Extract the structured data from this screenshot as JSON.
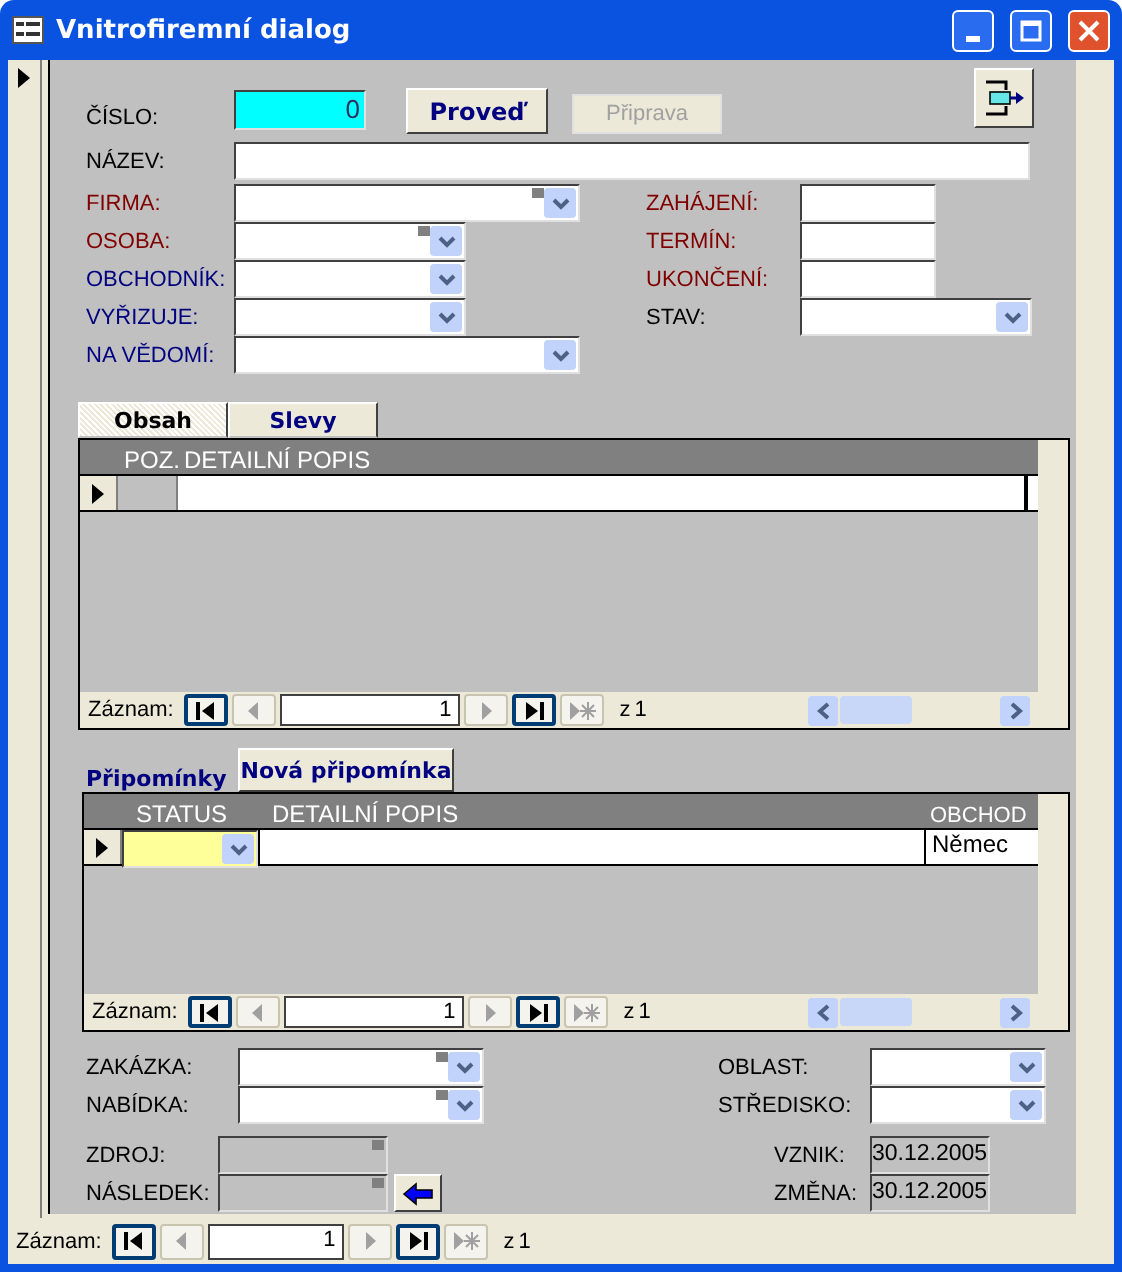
{
  "window": {
    "title": "Vnitrofiremní dialog"
  },
  "record_selector": {
    "current": true
  },
  "header": {
    "number": {
      "label": "ČÍSLO:",
      "value": "0"
    },
    "buttons": [
      {
        "label": "Proveď",
        "disabled": false
      },
      {
        "label": "Připrava",
        "disabled": true
      }
    ],
    "name": {
      "label": "NÁZEV:"
    }
  },
  "fields_left": [
    {
      "label": "FIRMA:",
      "color": "#800000",
      "kind": "combo",
      "tagged": true
    },
    {
      "label": "OSOBA:",
      "color": "#800000",
      "kind": "combo",
      "tagged": true
    },
    {
      "label": "OBCHODNÍK:",
      "color": "#000080",
      "kind": "combo",
      "tagged": false
    },
    {
      "label": "VYŘIZUJE:",
      "color": "#000080",
      "kind": "combo",
      "tagged": false
    },
    {
      "label": "NA VĚDOMÍ:",
      "color": "#000080",
      "kind": "combo",
      "tagged": false
    }
  ],
  "fields_right": [
    {
      "label": "ZAHÁJENÍ:",
      "color": "#800000",
      "kind": "text"
    },
    {
      "label": "TERMÍN:",
      "color": "#800000",
      "kind": "text"
    },
    {
      "label": "UKONČENÍ:",
      "color": "#800000",
      "kind": "text"
    },
    {
      "label": "STAV:",
      "color": "#000000",
      "kind": "combo"
    }
  ],
  "tabs": [
    {
      "label": "Obsah",
      "selected": true
    },
    {
      "label": "Slevy",
      "selected": false
    }
  ],
  "items_table": {
    "columns": [
      "POZ.",
      "DETAILNÍ POPIS"
    ],
    "rows": [
      {
        "current": true
      }
    ],
    "nav": {
      "label": "Záznam:",
      "value": "1",
      "of": "z",
      "total": "1",
      "buttons": [
        {
          "kind": "first",
          "disabled": false
        },
        {
          "kind": "prev",
          "disabled": true
        },
        {
          "kind": "next",
          "disabled": true
        },
        {
          "kind": "last",
          "disabled": false
        },
        {
          "kind": "new",
          "disabled": true
        }
      ]
    }
  },
  "reminders": {
    "title": "Připomínky",
    "new_button": "Nová připomínka",
    "columns": [
      "STATUS",
      "DETAILNÍ POPIS",
      "OBCHOD"
    ],
    "rows": [
      {
        "current": true,
        "obchod": "Němec"
      }
    ],
    "nav": {
      "label": "Záznam:",
      "value": "1",
      "of": "z",
      "total": "1",
      "buttons": [
        {
          "kind": "first",
          "disabled": false
        },
        {
          "kind": "prev",
          "disabled": true
        },
        {
          "kind": "next",
          "disabled": true
        },
        {
          "kind": "last",
          "disabled": false
        },
        {
          "kind": "new",
          "disabled": true
        }
      ]
    }
  },
  "footer_left": [
    {
      "label": "ZAKÁZKA:",
      "tagged": true
    },
    {
      "label": "NABÍDKA:",
      "tagged": true
    }
  ],
  "footer_right": [
    {
      "label": "OBLAST:"
    },
    {
      "label": "STŘEDISKO:"
    }
  ],
  "links": [
    {
      "label": "ZDROJ:",
      "disabled": true,
      "tagged": true,
      "action": false
    },
    {
      "label": "NÁSLEDEK:",
      "disabled": true,
      "tagged": true,
      "action": true
    }
  ],
  "dates": [
    {
      "label": "VZNIK:",
      "value": "30.12.2005"
    },
    {
      "label": "ZMĚNA:",
      "value": "30.12.2005"
    }
  ],
  "main_nav": {
    "label": "Záznam:",
    "value": "1",
    "of": "z",
    "total": "1",
    "buttons": [
      {
        "kind": "first",
        "disabled": false
      },
      {
        "kind": "prev",
        "disabled": true
      },
      {
        "kind": "next",
        "disabled": true
      },
      {
        "kind": "last",
        "disabled": false
      },
      {
        "kind": "new",
        "disabled": true
      }
    ]
  }
}
